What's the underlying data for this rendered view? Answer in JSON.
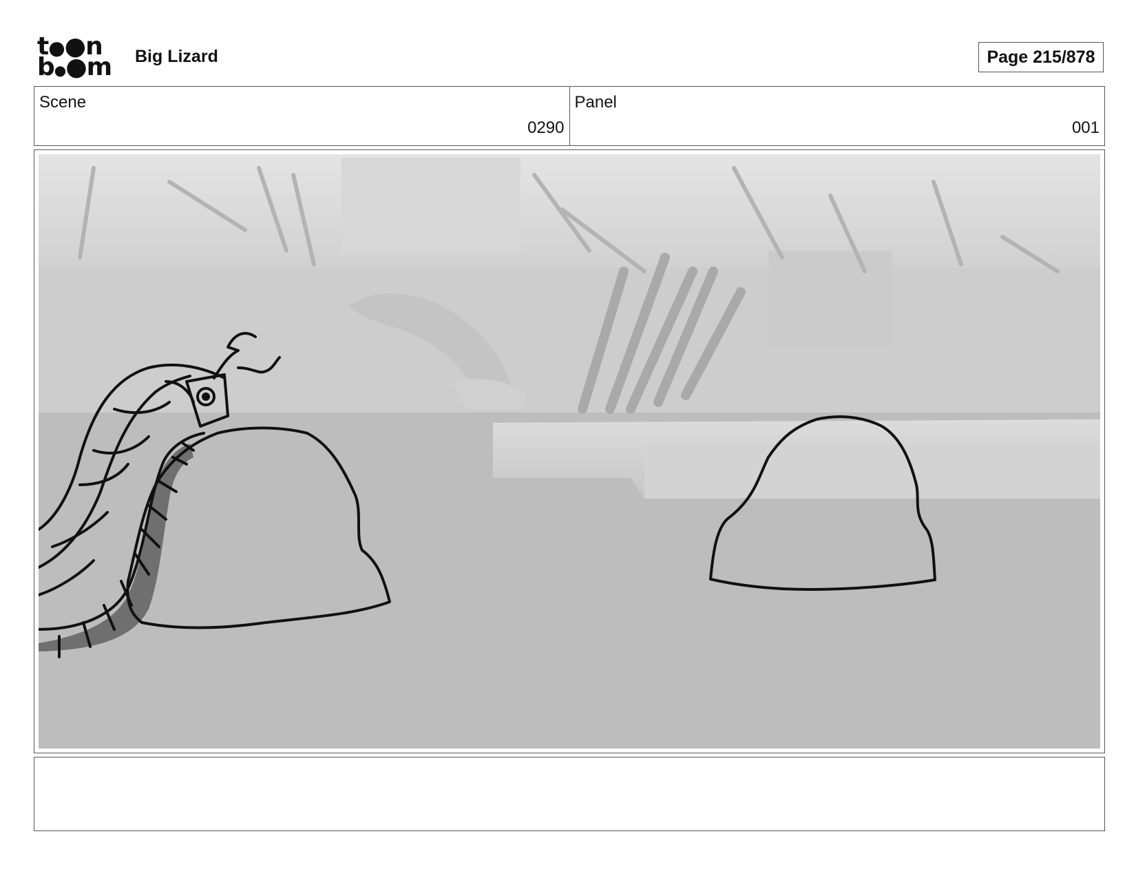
{
  "header": {
    "logo_alt": "toon boom",
    "project_title": "Big Lizard",
    "page_label": "Page 215/878"
  },
  "info": {
    "scene_label": "Scene",
    "scene_value": "0290",
    "panel_label": "Panel",
    "panel_value": "001"
  },
  "panel": {
    "background_color": "#bdbdbd",
    "line_color": "#111111"
  },
  "notes": {
    "text": ""
  }
}
